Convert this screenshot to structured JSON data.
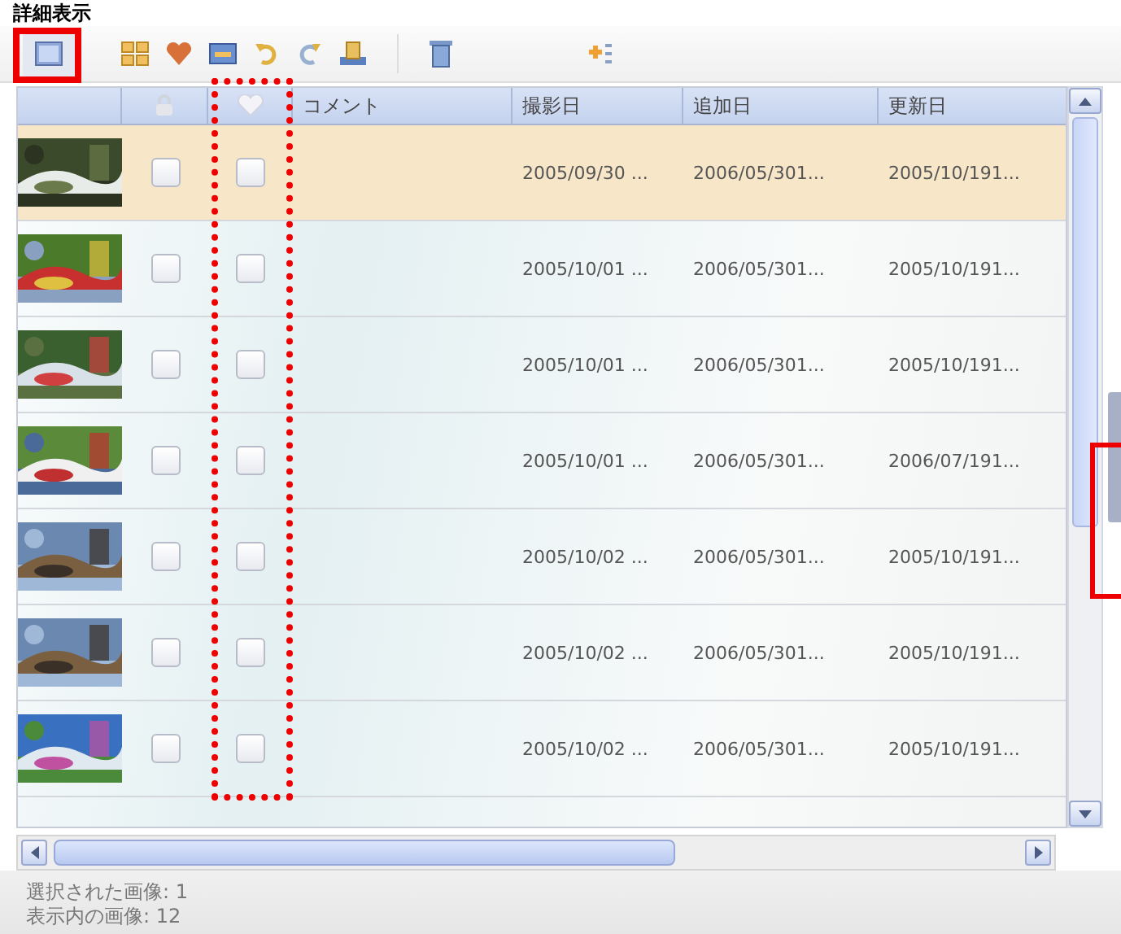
{
  "title": "詳細表示",
  "toolbar": {
    "view_button": {
      "selected": true
    }
  },
  "table": {
    "columns": [
      {
        "kind": "thumb"
      },
      {
        "kind": "lock"
      },
      {
        "kind": "heart"
      },
      {
        "kind": "text",
        "label": "コメント"
      },
      {
        "kind": "text",
        "label": "撮影日"
      },
      {
        "kind": "text",
        "label": "追加日"
      },
      {
        "kind": "text",
        "label": "更新日"
      }
    ],
    "rows": [
      {
        "selected": true,
        "locked": false,
        "favorite": false,
        "comment": "",
        "taken": "2005/09/30 ...",
        "added": "2006/05/301...",
        "updated": "2005/10/191..."
      },
      {
        "selected": false,
        "locked": false,
        "favorite": false,
        "comment": "",
        "taken": "2005/10/01 ...",
        "added": "2006/05/301...",
        "updated": "2005/10/191..."
      },
      {
        "selected": false,
        "locked": false,
        "favorite": false,
        "comment": "",
        "taken": "2005/10/01 ...",
        "added": "2006/05/301...",
        "updated": "2005/10/191..."
      },
      {
        "selected": false,
        "locked": false,
        "favorite": false,
        "comment": "",
        "taken": "2005/10/01 ...",
        "added": "2006/05/301...",
        "updated": "2006/07/191..."
      },
      {
        "selected": false,
        "locked": false,
        "favorite": false,
        "comment": "",
        "taken": "2005/10/02 ...",
        "added": "2006/05/301...",
        "updated": "2005/10/191..."
      },
      {
        "selected": false,
        "locked": false,
        "favorite": false,
        "comment": "",
        "taken": "2005/10/02 ...",
        "added": "2006/05/301...",
        "updated": "2005/10/191..."
      },
      {
        "selected": false,
        "locked": false,
        "favorite": false,
        "comment": "",
        "taken": "2005/10/02 ...",
        "added": "2006/05/301...",
        "updated": "2005/10/191..."
      }
    ]
  },
  "status": [
    "選択された画像: 1",
    "表示内の画像: 12"
  ]
}
